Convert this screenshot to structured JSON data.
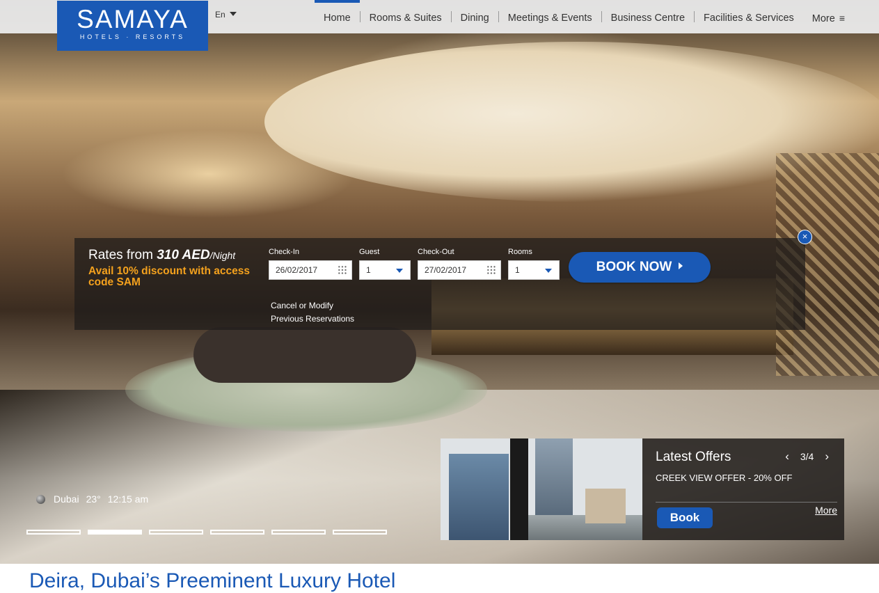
{
  "brand": {
    "name": "SAMAYA",
    "tagline": "HOTELS · RESORTS",
    "color": "#1a59b5"
  },
  "language": {
    "selected": "En"
  },
  "nav": {
    "items": [
      "Home",
      "Rooms & Suites",
      "Dining",
      "Meetings & Events",
      "Business Centre",
      "Facilities & Services"
    ],
    "active": "Home",
    "more_label": "More",
    "more_icon": "≡"
  },
  "booking": {
    "rates_prefix": "Rates from",
    "rates_price": "310 AED",
    "rates_unit": "/Night",
    "promo": "Avail 10% discount with access code SAM",
    "checkin_label": "Check-In",
    "checkin_value": "26/02/2017",
    "guest_label": "Guest",
    "guest_value": "1",
    "checkout_label": "Check-Out",
    "checkout_value": "27/02/2017",
    "rooms_label": "Rooms",
    "rooms_value": "1",
    "book_now": "BOOK NOW",
    "cancel_line1": "Cancel or Modify",
    "cancel_line2": "Previous Reservations",
    "close_icon": "×"
  },
  "weather": {
    "city": "Dubai",
    "temp": "23°",
    "time": "12:15 am"
  },
  "slider": {
    "count": 6,
    "active_index": 1
  },
  "offers": {
    "title": "Latest Offers",
    "position": "3/4",
    "prev_icon": "‹",
    "next_icon": "›",
    "description": "CREEK VIEW OFFER - 20% OFF",
    "book_label": "Book",
    "more_label": "More"
  },
  "headline": "Deira, Dubai’s Preeminent Luxury Hotel",
  "colors": {
    "accent": "#1a59b5",
    "promo": "#f4a11d"
  }
}
